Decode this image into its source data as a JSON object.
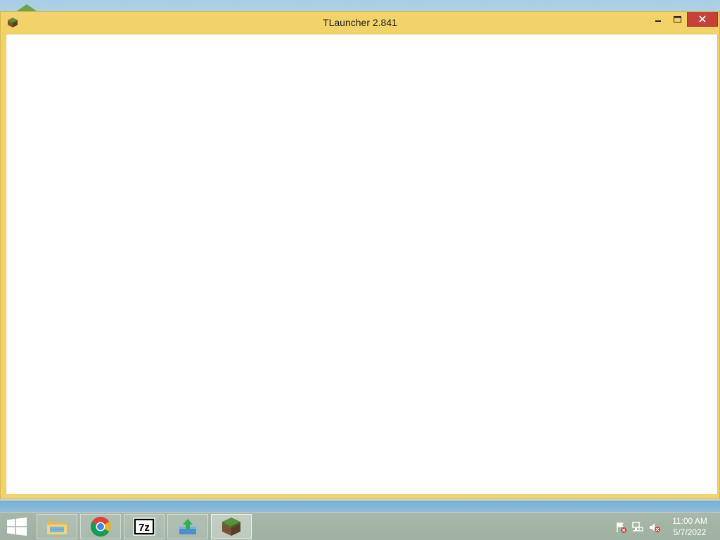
{
  "window": {
    "title": "TLauncher 2.841",
    "controls": {
      "minimize": "minimize",
      "maximize": "maximize",
      "close": "close"
    }
  },
  "taskbar": {
    "apps": [
      {
        "name": "File Explorer",
        "icon": "folder-icon"
      },
      {
        "name": "Google Chrome",
        "icon": "chrome-icon"
      },
      {
        "name": "7-Zip",
        "icon": "7zip-icon",
        "label": "7z"
      },
      {
        "name": "Installer",
        "icon": "download-icon"
      },
      {
        "name": "TLauncher",
        "icon": "grass-block-icon",
        "active": true
      }
    ],
    "tray": [
      "flag-icon",
      "network-icon",
      "volume-muted-icon"
    ],
    "clock": {
      "time": "11:00 AM",
      "date": "5/7/2022"
    }
  },
  "colors": {
    "window_frame": "#f2d36a",
    "close_button": "#c8403a",
    "taskbar": "#a7b8a8"
  }
}
